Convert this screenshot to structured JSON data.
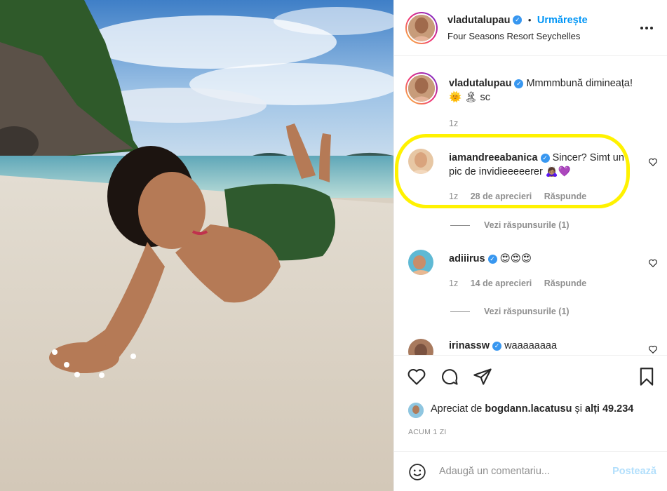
{
  "post": {
    "author": "vladutalupau",
    "follow_label": "Urmărește",
    "follow_dot": "•",
    "location": "Four Seasons Resort Seychelles",
    "more_icon": "more-horizontal-icon"
  },
  "caption": {
    "author": "vladutalupau",
    "text": "Mmmmbună dimineața!",
    "text2": "🌞 🏝 sc",
    "time": "1z"
  },
  "comments": [
    {
      "author": "iamandreeabanica",
      "text": "Sincer? Simt un pic de invidieeeeerer 🙇🏽‍♀️💜",
      "time": "1z",
      "likes": "28 de aprecieri",
      "reply_label": "Răspunde",
      "view_replies": "Vezi răspunsurile (1)"
    },
    {
      "author": "adiiirus",
      "text": "😍😍😍",
      "time": "1z",
      "likes": "14 de aprecieri",
      "reply_label": "Răspunde",
      "view_replies": "Vezi răspunsurile (1)"
    },
    {
      "author": "irinassw",
      "text": "waaaaaaaa"
    }
  ],
  "likes_summary": {
    "prefix": "Apreciat de",
    "user": "bogdann.lacatusu",
    "suffix_and": "și",
    "others": "alți 49.234"
  },
  "timestamp": "ACUM 1 ZI",
  "comment_box": {
    "placeholder": "Adaugă un comentariu...",
    "post_label": "Postează"
  },
  "colors": {
    "accent": "#0095f6",
    "highlight": "#fff200",
    "verified": "#3897f0"
  }
}
